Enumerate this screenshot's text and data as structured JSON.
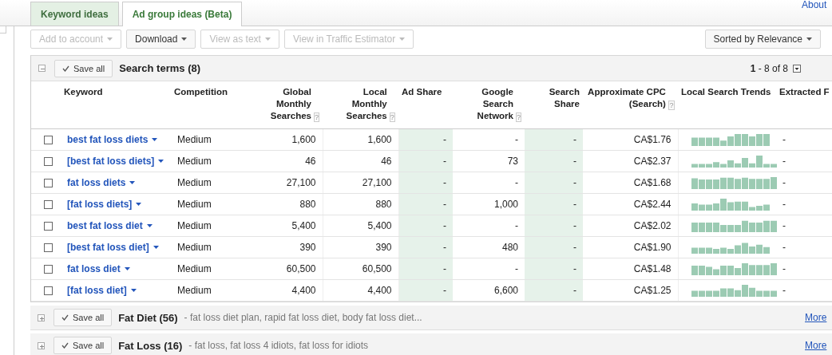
{
  "about_link": "About",
  "tabs": [
    {
      "label": "Keyword ideas",
      "selected": false
    },
    {
      "label": "Ad group ideas (Beta)",
      "selected": true
    }
  ],
  "toolbar": {
    "buttons": [
      {
        "label": "Add to account",
        "disabled": true
      },
      {
        "label": "Download",
        "disabled": false
      },
      {
        "label": "View as text",
        "disabled": true
      },
      {
        "label": "View in Traffic Estimator",
        "disabled": true
      }
    ],
    "sort": "Sorted by Relevance"
  },
  "groups": [
    {
      "title": "Search terms (8)",
      "expanded": true,
      "save": "Save all",
      "pager": "**1** - 8 of 8",
      "columns": [
        {
          "label": "Keyword"
        },
        {
          "label": "Competition"
        },
        {
          "label": "Global Monthly Searches",
          "help": "?"
        },
        {
          "label": "Local Monthly Searches",
          "help": "?"
        },
        {
          "label": "Ad Share"
        },
        {
          "label": "Google Search Network",
          "help": "?"
        },
        {
          "label": "Search Share"
        },
        {
          "label": "Approximate CPC (Search)",
          "help": "?"
        },
        {
          "label": "Local Search Trends"
        },
        {
          "label": "Extracted F"
        }
      ],
      "rows": [
        {
          "checked": false,
          "keyword": "best fat loss diets",
          "competition": "Medium",
          "global": "1,600",
          "local": "1,600",
          "ad_share": "-",
          "google_search_network": "-",
          "search_share": "-",
          "cpc": "CA$1.76",
          "extracted": "-"
        },
        {
          "checked": false,
          "keyword": "[best fat loss diets]",
          "competition": "Medium",
          "global": "46",
          "local": "46",
          "ad_share": "-",
          "google_search_network": "73",
          "search_share": "-",
          "cpc": "CA$2.37",
          "extracted": "-"
        },
        {
          "checked": false,
          "keyword": "fat loss diets",
          "competition": "Medium",
          "global": "27,100",
          "local": "27,100",
          "ad_share": "-",
          "google_search_network": "-",
          "search_share": "-",
          "cpc": "CA$1.68",
          "extracted": "-"
        },
        {
          "checked": false,
          "keyword": "[fat loss diets]",
          "competition": "Medium",
          "global": "880",
          "local": "880",
          "ad_share": "-",
          "google_search_network": "1,000",
          "search_share": "-",
          "cpc": "CA$2.44",
          "extracted": "-"
        },
        {
          "checked": false,
          "keyword": "best fat loss diet",
          "competition": "Medium",
          "global": "5,400",
          "local": "5,400",
          "ad_share": "-",
          "google_search_network": "-",
          "search_share": "-",
          "cpc": "CA$2.02",
          "extracted": "-"
        },
        {
          "checked": false,
          "keyword": "[best fat loss diet]",
          "competition": "Medium",
          "global": "390",
          "local": "390",
          "ad_share": "-",
          "google_search_network": "480",
          "search_share": "-",
          "cpc": "CA$1.90",
          "extracted": "-"
        },
        {
          "checked": false,
          "keyword": "fat loss diet",
          "competition": "Medium",
          "global": "60,500",
          "local": "60,500",
          "ad_share": "-",
          "google_search_network": "-",
          "search_share": "-",
          "cpc": "CA$1.48",
          "extracted": "-"
        },
        {
          "checked": false,
          "keyword": "[fat loss diet]",
          "competition": "Medium",
          "global": "4,400",
          "local": "4,400",
          "ad_share": "-",
          "google_search_network": "6,600",
          "search_share": "-",
          "cpc": "CA$1.25",
          "extracted": "-"
        }
      ]
    },
    {
      "title": "Fat Diet (56)",
      "expanded": false,
      "save": "Save all",
      "summary": "- fat loss diet plan, rapid fat loss diet, body fat loss diet...",
      "more": "More"
    },
    {
      "title": "Fat Loss (16)",
      "expanded": false,
      "save": "Save all",
      "summary": "- fat loss, fat loss 4 idiots, fat loss for idiots",
      "more": "More"
    }
  ]
}
